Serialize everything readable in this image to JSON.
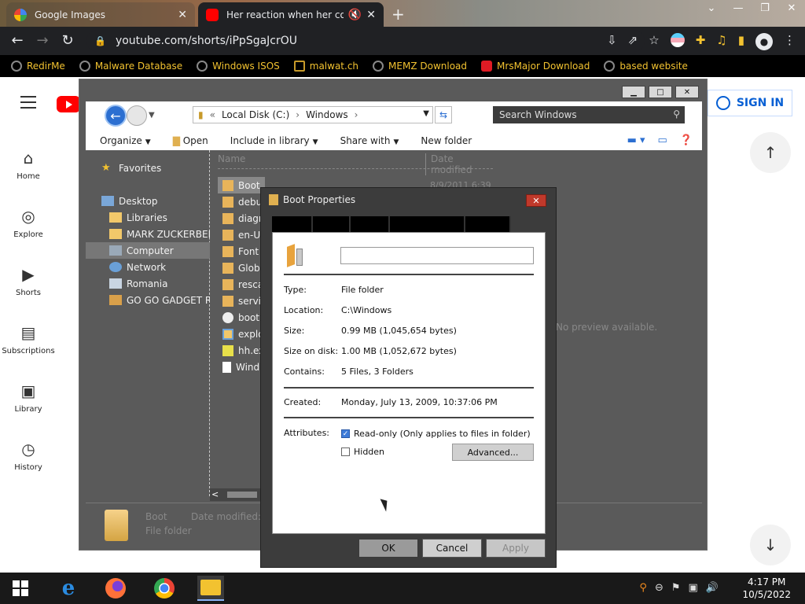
{
  "browser": {
    "tabs": [
      {
        "title": "Google Images",
        "active": false
      },
      {
        "title": "Her reaction when her cousi",
        "active": true
      }
    ],
    "url": "youtube.com/shorts/iPpSgaJcrOU",
    "bookmarks": [
      {
        "label": "RedirMe"
      },
      {
        "label": "Malware Database"
      },
      {
        "label": "Windows ISOS"
      },
      {
        "label": "malwat.ch"
      },
      {
        "label": "MEMZ Download"
      },
      {
        "label": "MrsMajor Download"
      },
      {
        "label": "based website"
      }
    ]
  },
  "youtube": {
    "signin_label": "SIGN IN",
    "sidebar": [
      {
        "label": "Home",
        "icon": "home-icon"
      },
      {
        "label": "Explore",
        "icon": "compass-icon"
      },
      {
        "label": "Shorts",
        "icon": "shorts-icon"
      },
      {
        "label": "Subscriptions",
        "icon": "subscriptions-icon"
      },
      {
        "label": "Library",
        "icon": "library-icon"
      },
      {
        "label": "History",
        "icon": "history-icon"
      }
    ]
  },
  "explorer": {
    "breadcrumb": [
      "Local Disk (C:)",
      "Windows"
    ],
    "search_placeholder": "Search Windows",
    "commands": [
      {
        "label": "Organize",
        "dropdown": true
      },
      {
        "label": "Open",
        "dropdown": false
      },
      {
        "label": "Include in library",
        "dropdown": true
      },
      {
        "label": "Share with",
        "dropdown": true
      },
      {
        "label": "New folder",
        "dropdown": false
      }
    ],
    "nav_items": [
      {
        "label": "Favorites",
        "icon": "star-icon",
        "indent": 1,
        "selected": false
      },
      {
        "label": "Desktop",
        "icon": "desktop-icon",
        "indent": 1,
        "selected": false
      },
      {
        "label": "Libraries",
        "icon": "folder-icon",
        "indent": 2,
        "selected": false
      },
      {
        "label": "MARK ZUCKERBERG",
        "icon": "folder-icon",
        "indent": 2,
        "selected": false
      },
      {
        "label": "Computer",
        "icon": "computer-icon",
        "indent": 2,
        "selected": true
      },
      {
        "label": "Network",
        "icon": "network-icon",
        "indent": 2,
        "selected": false
      },
      {
        "label": "Romania",
        "icon": "user-icon",
        "indent": 2,
        "selected": false
      },
      {
        "label": "GO GO GADGET RA",
        "icon": "folder-icon",
        "indent": 2,
        "selected": false
      }
    ],
    "header_name": "Name",
    "header_date": "Date modified",
    "files": [
      {
        "label": "Boot",
        "icon": "folder-icon",
        "selected": true
      },
      {
        "label": "debu",
        "icon": "folder-icon",
        "selected": false
      },
      {
        "label": "diagn",
        "icon": "folder-icon",
        "selected": false
      },
      {
        "label": "en-U",
        "icon": "folder-icon",
        "selected": false
      },
      {
        "label": "Font",
        "icon": "folder-icon",
        "selected": false
      },
      {
        "label": "Glob",
        "icon": "folder-icon",
        "selected": false
      },
      {
        "label": "resca",
        "icon": "folder-icon",
        "selected": false
      },
      {
        "label": "servi",
        "icon": "folder-icon",
        "selected": false
      },
      {
        "label": "boot",
        "icon": "file-icon",
        "selected": false
      },
      {
        "label": "explo",
        "icon": "app-icon",
        "selected": false
      },
      {
        "label": "hh.ex",
        "icon": "help-icon",
        "selected": false
      },
      {
        "label": "Wind",
        "icon": "text-file-icon",
        "selected": false
      }
    ],
    "first_date": "8/9/2011 6:39 P",
    "no_preview": "No preview available.",
    "details_name": "Boot",
    "details_type": "File folder",
    "details_modified_label": "Date modified:"
  },
  "dialog": {
    "title": "Boot Properties",
    "name_value": "",
    "rows": [
      {
        "label": "Type:",
        "value": "File folder"
      },
      {
        "label": "Location:",
        "value": "C:\\Windows"
      },
      {
        "label": "Size:",
        "value": "0.99 MB (1,045,654 bytes)"
      },
      {
        "label": "Size on disk:",
        "value": "1.00 MB (1,052,672 bytes)"
      },
      {
        "label": "Contains:",
        "value": "5 Files, 3 Folders"
      }
    ],
    "created_label": "Created:",
    "created_value": "Monday, July 13, 2009, 10:37:06 PM",
    "attributes_label": "Attributes:",
    "readonly_label": "Read-only (Only applies to files in folder)",
    "readonly_checked": true,
    "hidden_label": "Hidden",
    "hidden_checked": false,
    "advanced_label": "Advanced...",
    "ok_label": "OK",
    "cancel_label": "Cancel",
    "apply_label": "Apply"
  },
  "taskbar": {
    "time": "4:17 PM",
    "date": "10/5/2022"
  }
}
